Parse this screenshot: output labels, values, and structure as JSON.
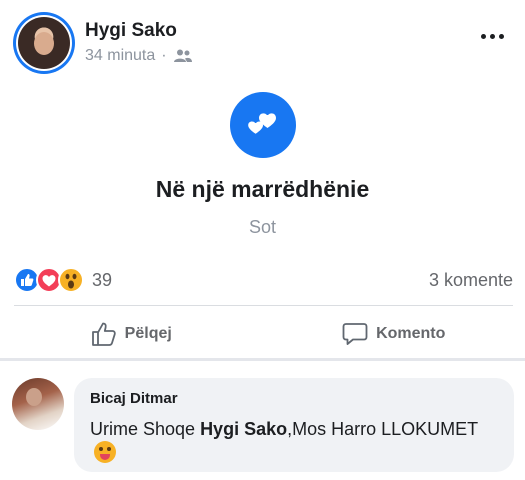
{
  "post": {
    "author": "Hygi Sako",
    "time": "34 minuta",
    "separator": "·",
    "audience_icon": "friends-icon",
    "more_icon": "more-options-icon"
  },
  "life_event": {
    "icon": "hearts-icon",
    "title": "Në një marrëdhënie",
    "date": "Sot"
  },
  "reactions": {
    "types": [
      "like",
      "love",
      "wow"
    ],
    "count": "39",
    "comments": "3 komente"
  },
  "actions": {
    "like_label": "Pëlqej",
    "comment_label": "Komento"
  },
  "comment": {
    "author": "Bicaj Ditmar",
    "text_before": "Urime Shoqe ",
    "mention": "Hygi Sako",
    "text_after": ",Mos Harro LLOKUMET",
    "emoji": "winking-tongue-emoji"
  },
  "colors": {
    "accent": "#1877f2",
    "love": "#f33e58",
    "wow": "#f7b125",
    "muted_text": "#8d949e"
  }
}
